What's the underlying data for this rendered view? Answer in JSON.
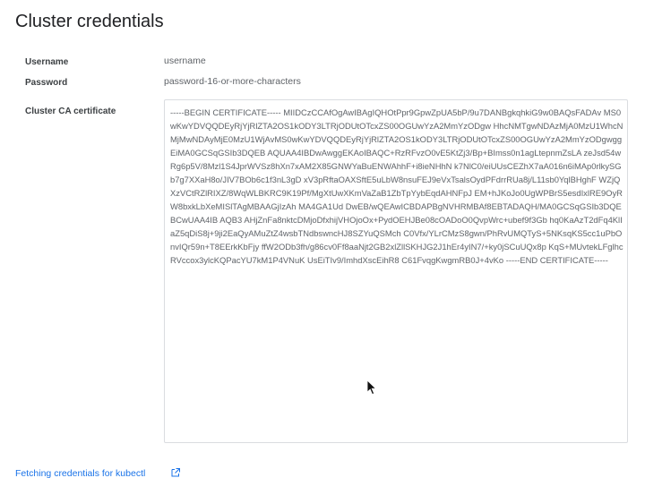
{
  "page": {
    "title": "Cluster credentials"
  },
  "fields": {
    "username": {
      "label": "Username",
      "value": "username"
    },
    "password": {
      "label": "Password",
      "value": "password-16-or-more-characters"
    },
    "ca_certificate": {
      "label": "Cluster CA certificate",
      "value": "-----BEGIN CERTIFICATE----- MIIDCzCCAfOgAwIBAgIQHOtPpr9GpwZpUA5bP/9u7DANBgkqhkiG9w0BAQsFADAv MS0wKwYDVQQDEyRjYjRlZTA2OS1kODY3LTRjODUtOTcxZS00OGUwYzA2MmYzODgw HhcNMTgwNDAzMjA0MzU1WhcNMjMwNDAyMjE0MzU1WjAvMS0wKwYDVQQDEyRjYjRlZTA2OS1kODY3LTRjODUtOTcxZS00OGUwYzA2MmYzODgwggEiMA0GCSqGSIb3DQEB AQUAA4IBDwAwggEKAoIBAQC+RzRFvzO0vE5KtZj3/Bp+BImss0n1agLtepnmZsLA zeJsd54wRg6p5V/8Mzl1S4JprWVSz8hXn7xAM2X85GNWYaBuENWAhhF+i8ieNHhN k7NlC0/eiUUsCEZhX7aA016n6iMAp0rlkySGb7g7XXaH8o/JIV7BOb6c1f3nL3gD xV3pRftaOAXSftE5uLbW8nsuFEJ9eVxTsalsOydPFdrrRUa8j/L11sb0YqlBHghF WZjQXzVCtRZlRIXZ/8WqWLBKRC9K19Pf/MgXtUwXKmVaZaB1ZbTpYybEqdAHNFpJ EM+hJKoJo0UgWPBrS5esdIxlRE9OyRW8bxkLbXeMISlTAgMBAAGjIzAh MA4GA1Ud DwEB/wQEAwICBDAPBgNVHRMBAf8EBTADAQH/MA0GCSqGSIb3DQEBCwUAA4IB AQB3 AHjZnFa8nktcDMjoDfxhijVHOjoOx+PydOEHJBe08cOADoO0QvpWrc+ubef9f3Gb hq0KaAzT2dFq4KlIaZ5qDiS8j+9ji2EaQyAMuZtZ4wsbTNdbswncHJ8SZYuQSMch C0Vfx/YLrCMzS8gwn/PhRvUMQTyS+5NKsqKS5cc1uPbOnvIQr59n+T8EErkKbFjy ffW2ODb3fh/g86cv0Ff8aaNjt2GB2xlZllSKHJG2J1hEr4yIN7/+ky0jSCuUQx8p KqS+MUvtekLFglhcRVccox3ylcKQPacYU7kM1P4VNuK UsEiTIv9/ImhdXscEihR8 C61FvqgKwgmRB0J+4vKo -----END CERTIFICATE-----"
    }
  },
  "footer": {
    "link_label": "Fetching credentials for kubectl",
    "link_icon": "external-link-icon"
  },
  "colors": {
    "link": "#1a73e8",
    "label": "#3c4043",
    "value": "#5f6368",
    "border": "#dadce0"
  }
}
